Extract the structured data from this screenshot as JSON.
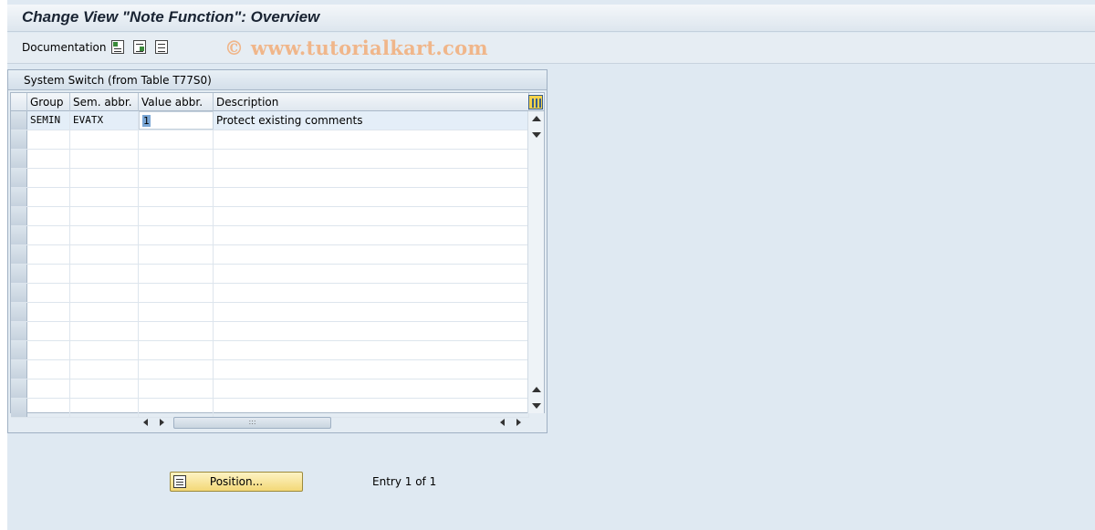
{
  "window": {
    "title": "Change View \"Note Function\": Overview"
  },
  "toolbar": {
    "documentation_label": "Documentation",
    "icons": [
      "select-all-icon",
      "select-block-icon",
      "deselect-all-icon"
    ]
  },
  "watermark": "© www.tutorialkart.com",
  "panel": {
    "title": "System Switch (from Table T77S0)",
    "columns": [
      "Group",
      "Sem. abbr.",
      "Value abbr.",
      "Description"
    ],
    "rows": [
      {
        "group": "SEMIN",
        "sem_abbr": "EVATX",
        "value_abbr": "1",
        "description": "Protect existing comments"
      }
    ]
  },
  "footer": {
    "position_button": "Position...",
    "entry_text": "Entry 1 of 1"
  },
  "colors": {
    "background": "#dfe9f2",
    "button_yellow": "#f3d877",
    "selected_value": "#7aa7d6"
  }
}
